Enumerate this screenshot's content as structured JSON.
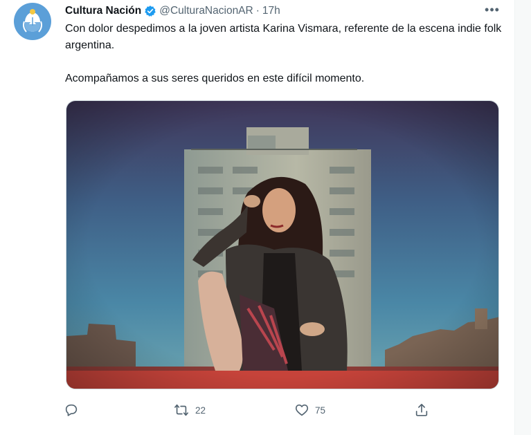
{
  "tweet": {
    "author_name": "Cultura Nación",
    "handle": "@CulturaNacionAR",
    "separator": "·",
    "time": "17h",
    "more_label": "•••",
    "paragraphs": [
      "Con dolor despedimos a la joven artista Karina Vismara, referente de la escena indie folk argentina.",
      "Acompañamos a sus seres queridos en este difícil momento."
    ],
    "media": {
      "description": "Photo of a young woman with long dark hair sitting on a rooftop in front of an apartment tower at sunset"
    },
    "actions": {
      "reply_count": "",
      "retweet_count": "22",
      "like_count": "75"
    }
  },
  "icons": {
    "avatar": "argentina-coat-of-arms-icon",
    "verified": "verified-badge-icon",
    "reply": "reply-icon",
    "retweet": "retweet-icon",
    "like": "heart-icon",
    "share": "share-icon",
    "more": "more-options-icon"
  },
  "colors": {
    "avatar_bg": "#5b9fd8",
    "verified": "#1d9bf0",
    "secondary_text": "#536471",
    "primary_text": "#0f1419"
  }
}
